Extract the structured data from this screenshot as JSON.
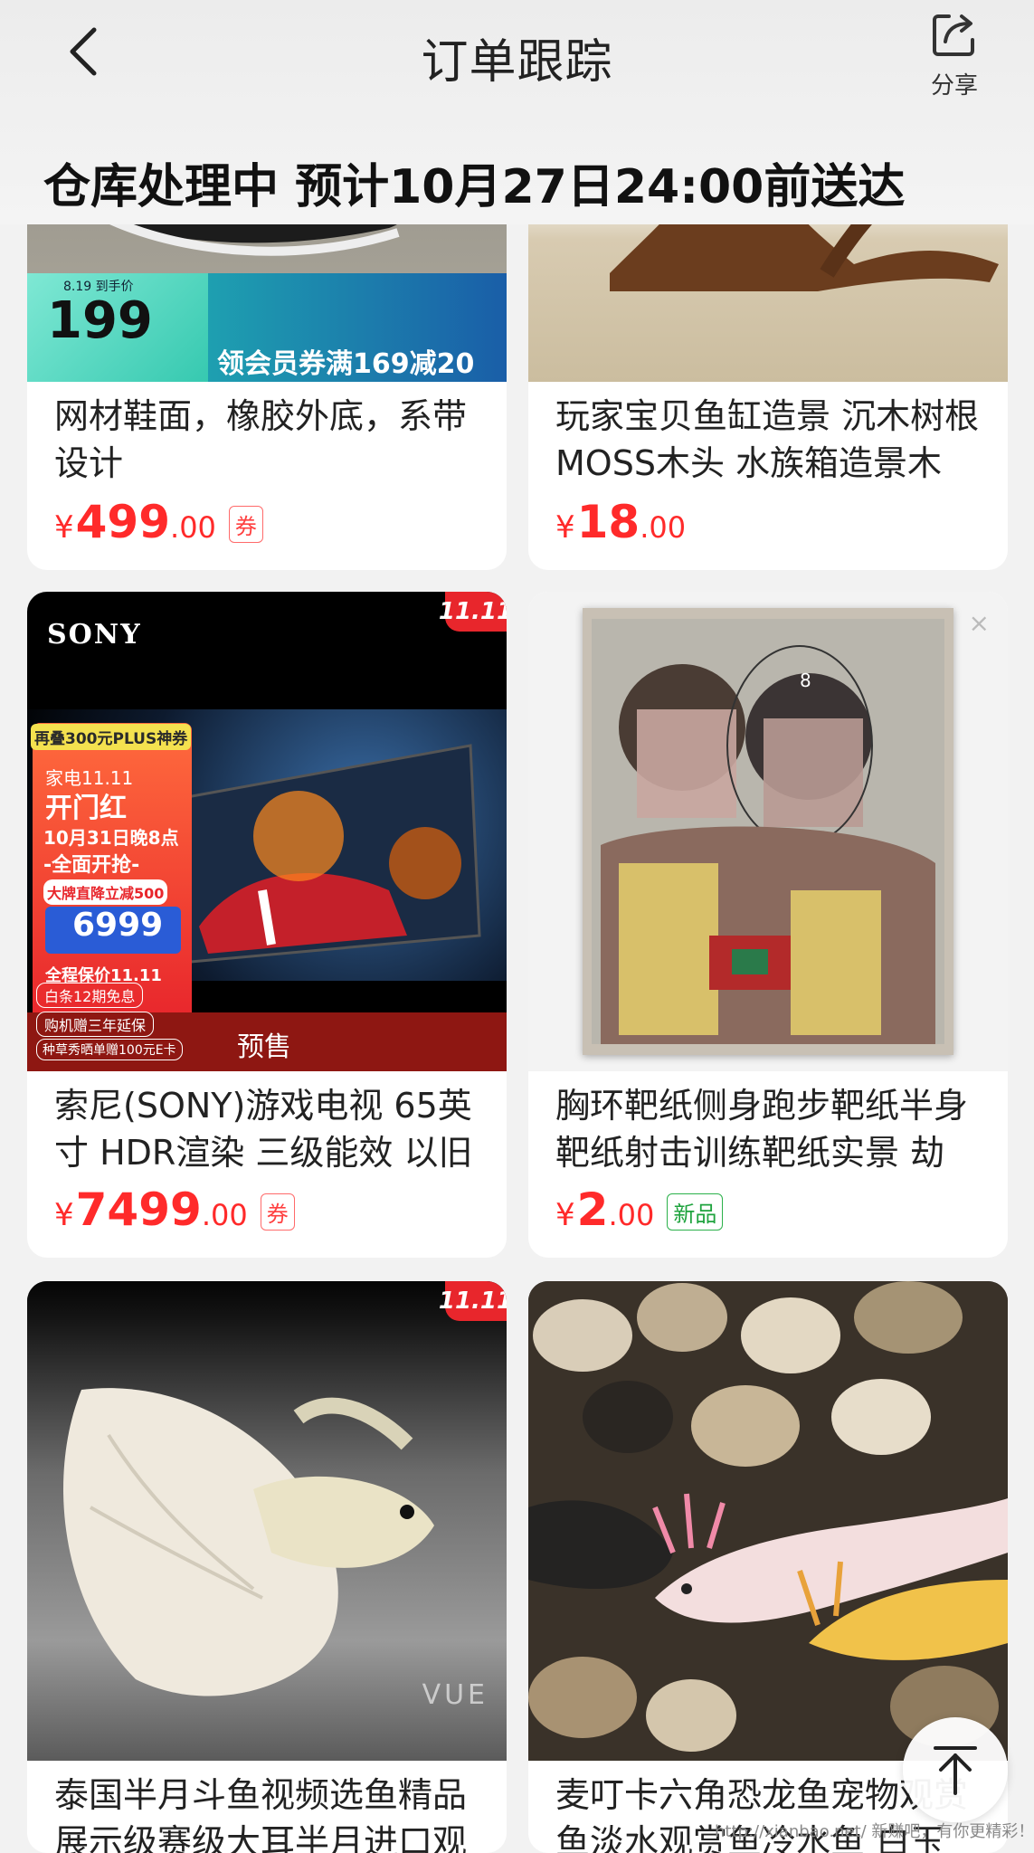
{
  "header": {
    "title": "订单跟踪",
    "share_label": "分享",
    "status": "仓库处理中 预计10月27日24:00前送达"
  },
  "products": [
    {
      "name": "网材鞋面，橡胶外底，系带设计",
      "price_currency": "¥",
      "price_int": "499",
      "price_dec": ".00",
      "tag": "券",
      "promo_banner": "领会员券满169减20",
      "promo_price": "199",
      "promo_small": "8.19 到手价"
    },
    {
      "name": "玩家宝贝鱼缸造景 沉木树根 MOSS木头 水族箱造景木",
      "price_currency": "¥",
      "price_int": "18",
      "price_dec": ".00"
    },
    {
      "name": "索尼(SONY)游戏电视 65英寸 HDR渲染 三级能效 以旧",
      "price_currency": "¥",
      "price_int": "7499",
      "price_dec": ".00",
      "tag": "券",
      "badge": "11.11",
      "brand": "SONY",
      "presale": "预售",
      "promo_price": "6999",
      "promo_lines": [
        "再叠300元PLUS神券",
        "家电11.11",
        "开门红",
        "10月31日晚8点",
        "-全面开抢-",
        "大牌直降立减500",
        "全程保价11.11",
        "白条12期免息",
        "购机赠三年延保",
        "种草秀晒单赠100元E卡"
      ]
    },
    {
      "name": "胸环靶纸侧身跑步靶纸半身靶纸射击训练靶纸实景 劫",
      "price_currency": "¥",
      "price_int": "2",
      "price_dec": ".00",
      "tag": "新品"
    },
    {
      "name": "泰国半月斗鱼视频选鱼精品展示级赛级大耳半月进口观",
      "badge": "11.11",
      "watermark": "VUE"
    },
    {
      "name": "麦叮卡六角恐龙鱼宠物观赏鱼淡水观赏鱼冷水鱼 白玉"
    }
  ],
  "footer": {
    "watermark": "http://xianbao.net/ 新赚吧，有你更精彩！"
  },
  "colors": {
    "price_red": "#ff2a2a",
    "tag_green": "#1fa33e",
    "badge_red": "#e8262c"
  }
}
